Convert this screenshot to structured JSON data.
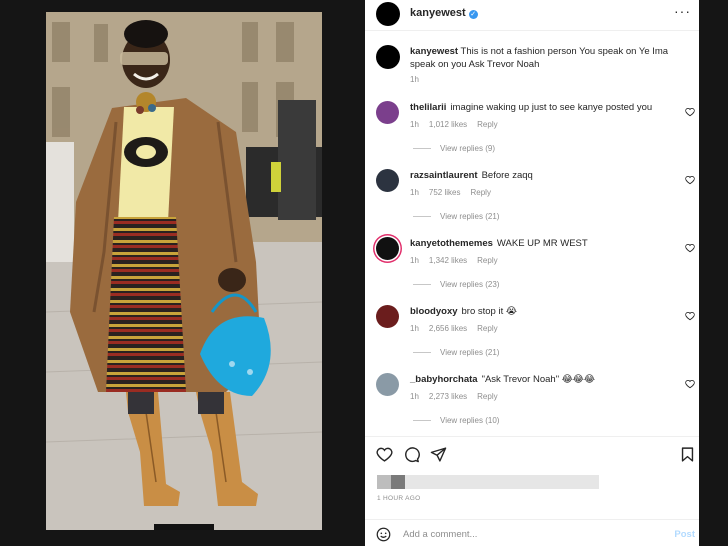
{
  "post": {
    "username": "kanyewest",
    "caption_user": "kanyewest",
    "caption_text": "This is not a fashion person You speak on Ye Ima speak on you Ask Trevor Noah",
    "caption_time": "1h"
  },
  "comments": [
    {
      "user": "thelilarii",
      "text": "imagine waking up just to see kanye posted you",
      "time": "1h",
      "likes": "1,012 likes",
      "reply": "Reply",
      "replies": "View replies (9)"
    },
    {
      "user": "razsaintlaurent",
      "text": "Before zaqq",
      "time": "1h",
      "likes": "752 likes",
      "reply": "Reply",
      "replies": "View replies (21)"
    },
    {
      "user": "kanyetothememes",
      "text": "WAKE UP MR WEST",
      "time": "1h",
      "likes": "1,342 likes",
      "reply": "Reply",
      "replies": "View replies (23)"
    },
    {
      "user": "bloodyoxy",
      "text": "bro stop it 😭",
      "time": "1h",
      "likes": "2,656 likes",
      "reply": "Reply",
      "replies": "View replies (21)"
    },
    {
      "user": "_babyhorchata",
      "text": "\"Ask Trevor Noah\" 😂😂😂",
      "time": "1h",
      "likes": "2,273 likes",
      "reply": "Reply",
      "replies": "View replies (10)"
    }
  ],
  "footer": {
    "timestamp": "1 HOUR AGO",
    "add_comment_placeholder": "Add a comment...",
    "post_label": "Post"
  },
  "icons": {
    "more": "more-options-icon",
    "verified": "verified-badge-icon",
    "heart": "heart-icon",
    "comment": "comment-bubble-icon",
    "share": "paper-plane-icon",
    "save": "bookmark-icon",
    "emoji": "emoji-icon"
  },
  "colors": {
    "verified": "#3897f0",
    "muted_text": "#8e8e8e",
    "post_button": "#b3dbff"
  }
}
